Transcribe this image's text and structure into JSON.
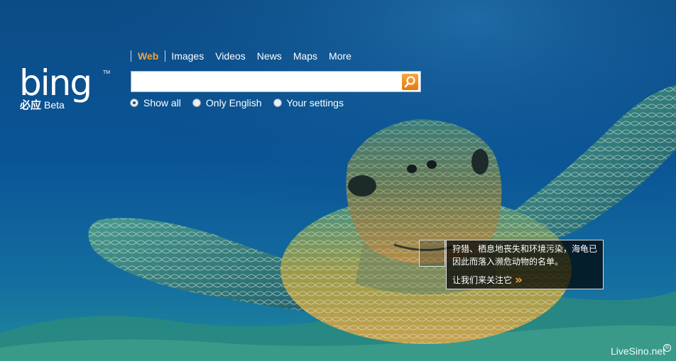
{
  "logo": {
    "wordmark": "bing",
    "trademark": "TM",
    "chinese": "必应",
    "beta": "Beta"
  },
  "nav": {
    "items": [
      {
        "label": "Web",
        "active": true
      },
      {
        "label": "Images"
      },
      {
        "label": "Videos"
      },
      {
        "label": "News"
      },
      {
        "label": "Maps"
      },
      {
        "label": "More"
      }
    ]
  },
  "search": {
    "value": "",
    "placeholder": "",
    "button_icon": "search-icon"
  },
  "options": [
    {
      "label": "Show all",
      "selected": true
    },
    {
      "label": "Only English",
      "selected": false
    },
    {
      "label": "Your settings",
      "selected": false
    }
  ],
  "info": {
    "text": "狩猎、栖息地丧失和环境污染，海龟已因此而落入濒危动物的名单。",
    "link": "让我们来关注它"
  },
  "watermark": {
    "text": "LiveSino.net",
    "symbol": "©"
  },
  "colors": {
    "accent": "#f0a33c",
    "ocean": "#0b4f8a"
  }
}
